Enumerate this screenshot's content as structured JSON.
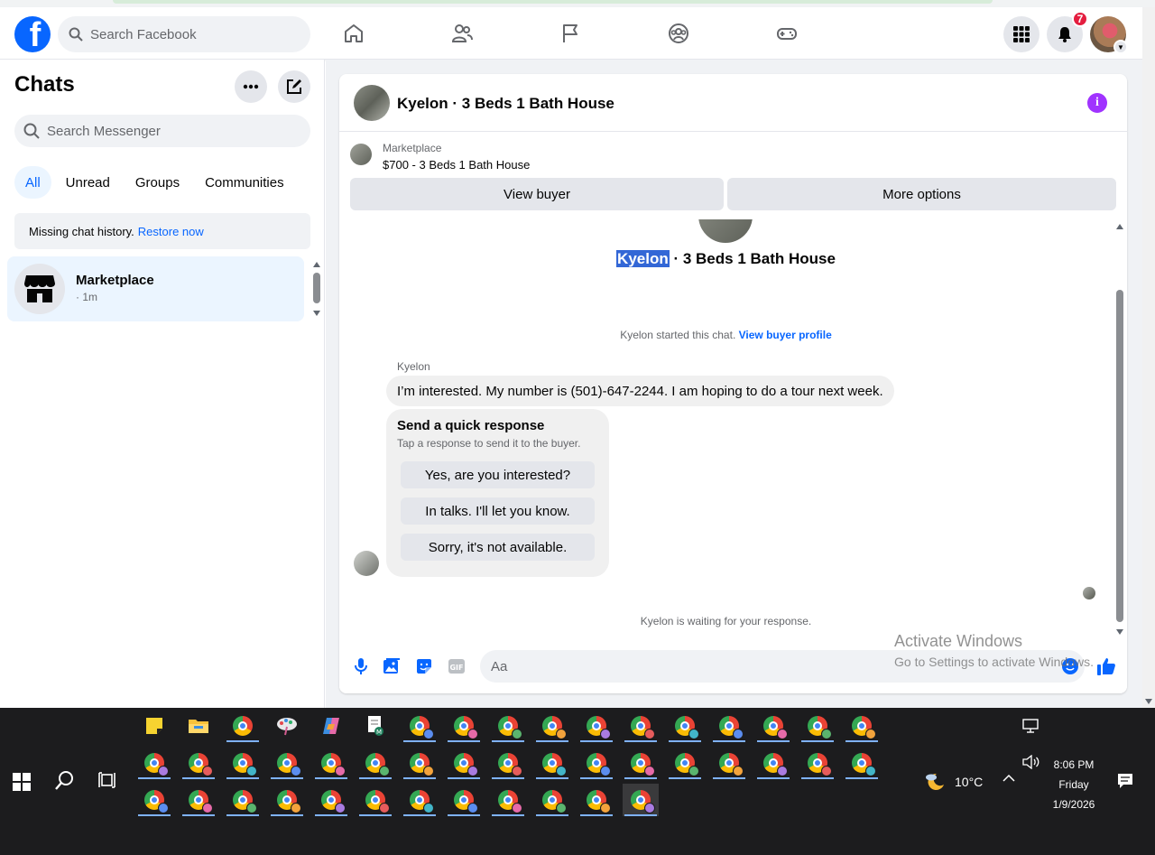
{
  "topbar": {
    "logo_letter": "f",
    "search_placeholder": "Search Facebook",
    "nav_icons": [
      "home-icon",
      "friends-icon",
      "pages-flag-icon",
      "groups-icon",
      "gaming-icon"
    ],
    "notification_count": "7"
  },
  "sidebar": {
    "title": "Chats",
    "search_placeholder": "Search Messenger",
    "filters": [
      {
        "label": "All",
        "active": true
      },
      {
        "label": "Unread",
        "active": false
      },
      {
        "label": "Groups",
        "active": false
      },
      {
        "label": "Communities",
        "active": false
      }
    ],
    "missing_history": "Missing chat history.",
    "restore_link": "Restore now",
    "chats": [
      {
        "name": "Marketplace",
        "time": "· 1m",
        "icon": "storefront-icon"
      }
    ]
  },
  "conversation": {
    "header_title": "Kyelon · 3 Beds 1 Bath House",
    "listing": {
      "label": "Marketplace",
      "price_title": "$700 - 3 Beds 1 Bath House",
      "view_buyer": "View buyer",
      "more_options": "More options"
    },
    "intro": {
      "name_highlight": "Kyelon",
      "name_rest": " · 3 Beds 1 Bath House",
      "started": "Kyelon started this chat.",
      "view_profile": "View buyer profile"
    },
    "sender_name": "Kyelon",
    "message": "I’m interested. My number is (501)-647-2244. I am hoping to do a tour next week.",
    "quick_response": {
      "title": "Send a quick response",
      "subtitle": "Tap a response to send it to the buyer.",
      "options": [
        "Yes, are you interested?",
        "In talks. I'll let you know.",
        "Sorry, it's not available."
      ]
    },
    "waiting": "Kyelon is waiting for your response.",
    "composer_placeholder": "Aa"
  },
  "watermark": {
    "line1": "Activate Windows",
    "line2": "Go to Settings to activate Windows."
  },
  "taskbar": {
    "pinned_row1": [
      "sticky-notes",
      "file-explorer",
      "chrome",
      "paint-app",
      "copilot",
      "notepad-app"
    ],
    "weather_temp": "10°C",
    "time": "8:06 PM",
    "day": "Friday",
    "date": "1/9/2026"
  },
  "colors": {
    "facebook_blue": "#0866ff",
    "info_purple": "#a033ff",
    "notification_red": "#e41e3f",
    "selection_blue": "#3367d6"
  }
}
